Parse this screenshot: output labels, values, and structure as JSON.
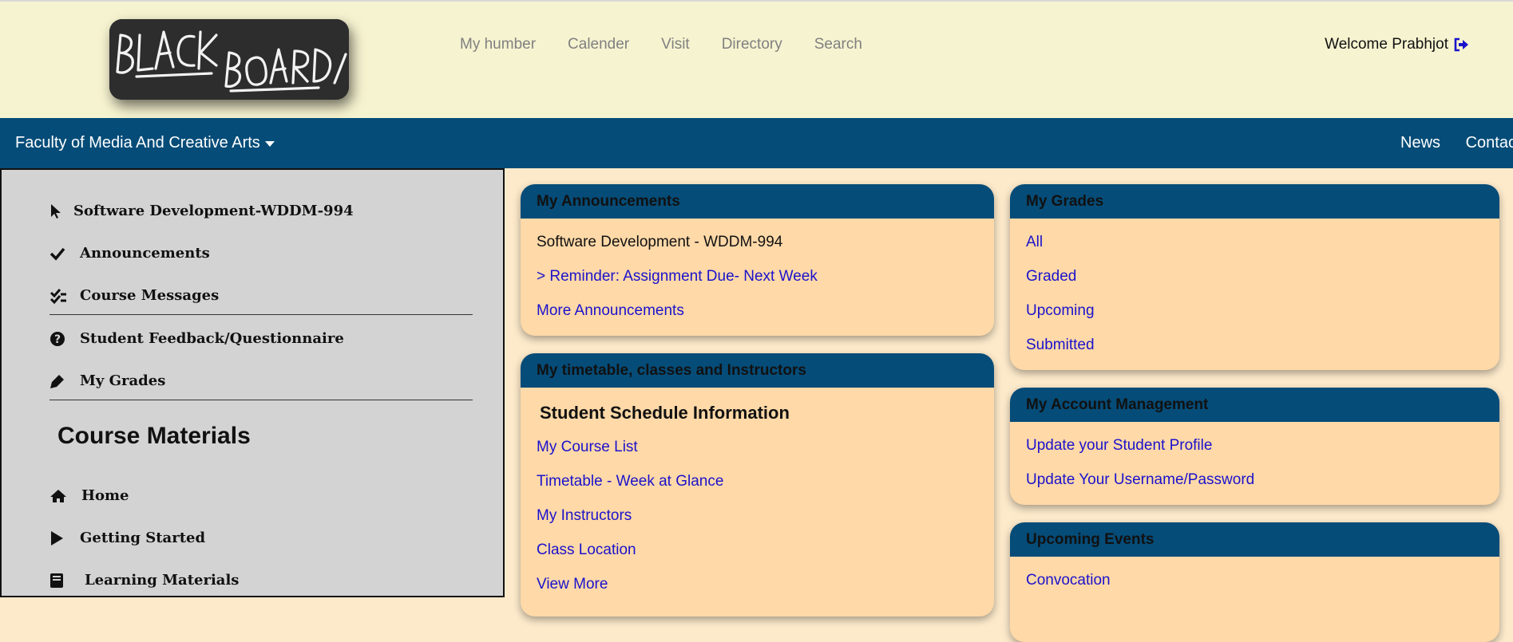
{
  "header": {
    "logo_text": "BLACK BOARD/",
    "nav": [
      "My humber",
      "Calender",
      "Visit",
      "Directory",
      "Search"
    ],
    "welcome": "Welcome Prabhjot",
    "welcome_icon": "sign-out-icon"
  },
  "subnav": {
    "faculty": "Faculty of Media And Creative Arts",
    "links": [
      "News",
      "Contact"
    ]
  },
  "sidebar": {
    "items_top": [
      {
        "label": "Software Development-WDDM-994",
        "icon": "pointer-icon"
      },
      {
        "label": "Announcements",
        "icon": "check-icon"
      },
      {
        "label": "Course Messages",
        "icon": "double-check-icon"
      },
      {
        "label": "Student Feedback/Questionnaire",
        "icon": "question-circle-icon"
      },
      {
        "label": "My Grades",
        "icon": "marker-icon"
      }
    ],
    "section_title": "Course Materials",
    "items_bottom": [
      {
        "label": "Home",
        "icon": "home-icon"
      },
      {
        "label": "Getting Started",
        "icon": "play-icon"
      },
      {
        "label": "Learning Materials",
        "icon": "book-icon"
      }
    ]
  },
  "cards": {
    "announcements": {
      "title": "My Announcements",
      "course": "Software Development - WDDM-994",
      "links": [
        "> Reminder: Assignment Due- Next Week",
        "More Announcements"
      ]
    },
    "timetable": {
      "title": "My timetable, classes and Instructors",
      "subtitle": "Student Schedule Information",
      "links": [
        "My Course List",
        "Timetable - Week at Glance",
        "My Instructors",
        "Class Location",
        "View More"
      ]
    },
    "grades": {
      "title": "My Grades",
      "links": [
        "All",
        "Graded",
        "Upcoming",
        "Submitted"
      ]
    },
    "account": {
      "title": "My Account Management",
      "links": [
        "Update your Student Profile",
        "Update Your Username/Password"
      ]
    },
    "events": {
      "title": "Upcoming Events",
      "links": [
        "Convocation"
      ]
    }
  },
  "colors": {
    "top_bg": "#f6f3d0",
    "nav_blue": "#054c78",
    "card_bg": "#ffd9a8",
    "link": "#1b12cc",
    "sidebar_bg": "#d3d3d3"
  }
}
